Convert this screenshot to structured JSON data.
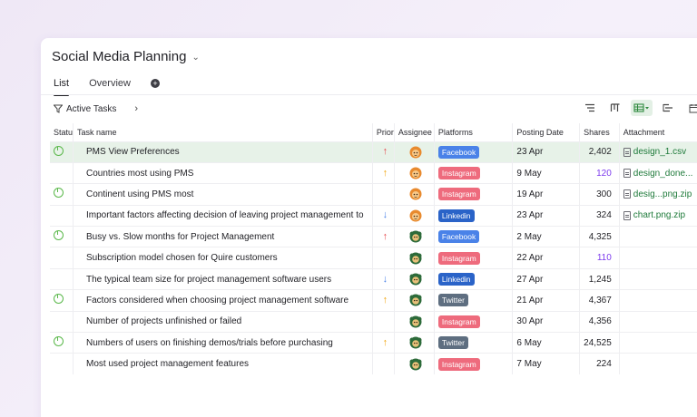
{
  "project": {
    "title": "Social Media Planning"
  },
  "tabs": [
    {
      "label": "List",
      "active": true
    },
    {
      "label": "Overview",
      "active": false
    }
  ],
  "filter": {
    "label": "Active Tasks"
  },
  "columns": [
    "Statu",
    "Task name",
    "Prior",
    "Assignee",
    "Platforms",
    "Posting Date",
    "Shares",
    "Attachment"
  ],
  "colors": {
    "accent_green": "#5ab84a",
    "highlight_row": "#e7f2e8",
    "platform_facebook": "#4a82e8",
    "platform_instagram": "#ee6b7d",
    "platform_linkedin": "#2a63c8",
    "platform_twitter": "#5e6e80",
    "priority_high": "#e5484d",
    "priority_medium": "#f0a30a",
    "priority_low": "#4a82e8",
    "shares_purple": "#7c3aed",
    "attachment_green": "#1e7a3a"
  },
  "rows": [
    {
      "status": "done",
      "name": "PMS View Preferences",
      "priority": "high",
      "assignee": "orange",
      "platform": "Facebook",
      "date": "23 Apr",
      "shares": "2,402",
      "shares_purple": false,
      "attachment": "design_1.csv",
      "highlighted": true
    },
    {
      "status": "",
      "name": "Countries most using PMS",
      "priority": "medium",
      "assignee": "orange",
      "platform": "Instagram",
      "date": "9 May",
      "shares": "120",
      "shares_purple": true,
      "attachment": "design_done...",
      "highlighted": false
    },
    {
      "status": "done",
      "name": "Continent using PMS most",
      "priority": "",
      "assignee": "orange",
      "platform": "Instagram",
      "date": "19 Apr",
      "shares": "300",
      "shares_purple": false,
      "attachment": "desig...png.zip",
      "highlighted": false
    },
    {
      "status": "",
      "name": "Important factors affecting decision of leaving project management to",
      "priority": "low",
      "assignee": "orange",
      "platform": "Linkedin",
      "date": "23 Apr",
      "shares": "324",
      "shares_purple": false,
      "attachment": "chart.png.zip",
      "highlighted": false
    },
    {
      "status": "done",
      "name": "Busy vs. Slow months for Project Management",
      "priority": "high",
      "assignee": "green",
      "platform": "Facebook",
      "date": "2 May",
      "shares": "4,325",
      "shares_purple": false,
      "attachment": "",
      "highlighted": false
    },
    {
      "status": "",
      "name": "Subscription model chosen for Quire customers",
      "priority": "",
      "assignee": "green",
      "platform": "Instagram",
      "date": "22 Apr",
      "shares": "110",
      "shares_purple": true,
      "attachment": "",
      "highlighted": false
    },
    {
      "status": "",
      "name": "The typical team size for project management software users",
      "priority": "low",
      "assignee": "green",
      "platform": "Linkedin",
      "date": "27 Apr",
      "shares": "1,245",
      "shares_purple": false,
      "attachment": "",
      "highlighted": false
    },
    {
      "status": "done",
      "name": "Factors considered when choosing project management software",
      "priority": "medium",
      "assignee": "green",
      "platform": "Twitter",
      "date": "21 Apr",
      "shares": "4,367",
      "shares_purple": false,
      "attachment": "",
      "highlighted": false
    },
    {
      "status": "",
      "name": "Number of projects unfinished or failed",
      "priority": "",
      "assignee": "green",
      "platform": "Instagram",
      "date": "30 Apr",
      "shares": "4,356",
      "shares_purple": false,
      "attachment": "",
      "highlighted": false
    },
    {
      "status": "done",
      "name": "Numbers of users on finishing demos/trials before purchasing",
      "priority": "medium",
      "assignee": "green",
      "platform": "Twitter",
      "date": "6 May",
      "shares": "24,525",
      "shares_purple": false,
      "attachment": "",
      "highlighted": false
    },
    {
      "status": "",
      "name": "Most used project management features",
      "priority": "",
      "assignee": "green",
      "platform": "Instagram",
      "date": "7 May",
      "shares": "224",
      "shares_purple": false,
      "attachment": "",
      "highlighted": false
    }
  ]
}
